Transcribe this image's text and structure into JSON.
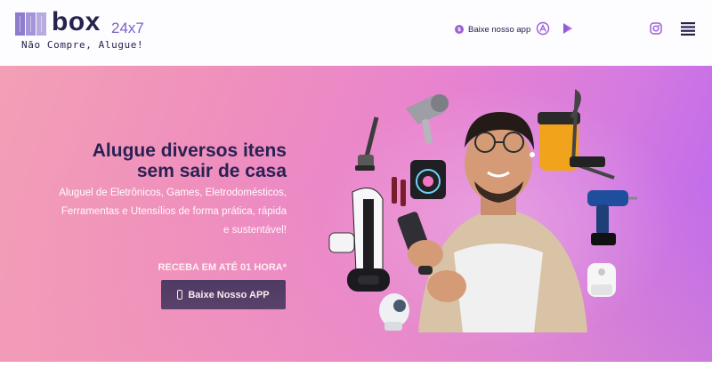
{
  "brand": {
    "word": "box",
    "suffix": "24x7",
    "tagline": "Não Compre, Alugue!"
  },
  "header": {
    "app_link_label": "Baixe nosso app",
    "icons": [
      "app-badge-icon",
      "app-store-icon",
      "google-play-icon",
      "instagram-icon",
      "hamburger-menu-icon"
    ]
  },
  "hero": {
    "title_line1": "Alugue diversos itens",
    "title_line2": "sem sair de casa",
    "subtitle_line1": "Aluguel de Eletrônicos, Games, Eletrodomésticos,",
    "subtitle_line2": "Ferramentas e Utensílios de forma prática, rápida",
    "subtitle_line3": "e sustentável!",
    "delivery": "RECEBA EM ATÉ 01 HORA*",
    "cta_label": "Baixe Nosso APP"
  },
  "colors": {
    "brand_dark": "#25224e",
    "brand_purple": "#7b63c6",
    "cta_bg": "#282351",
    "hero_pink": "#f3a0b6",
    "hero_violet": "#b866f0"
  }
}
